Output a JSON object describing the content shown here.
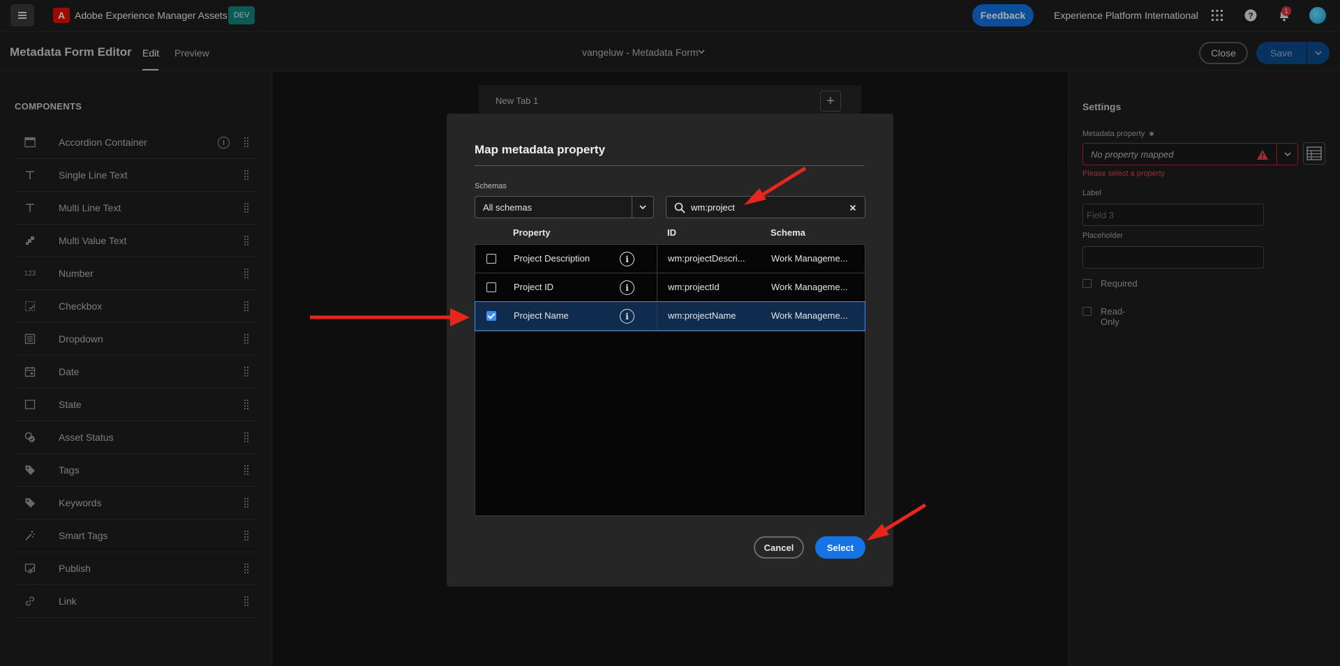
{
  "topbar": {
    "app_title": "Adobe Experience Manager Assets",
    "env_badge": "DEV",
    "feedback_label": "Feedback",
    "org_name": "Experience Platform International",
    "notification_count": "1"
  },
  "editor": {
    "title": "Metadata Form Editor",
    "tabs": [
      {
        "label": "Edit",
        "active": true
      },
      {
        "label": "Preview",
        "active": false
      }
    ],
    "form_name": "vangeluw - Metadata Form",
    "close_label": "Close",
    "save_label": "Save"
  },
  "components": {
    "heading": "COMPONENTS",
    "items": [
      {
        "label": "Accordion Container",
        "icon": "accordion-icon"
      },
      {
        "label": "Single Line Text",
        "icon": "text-icon"
      },
      {
        "label": "Multi Line Text",
        "icon": "text-icon"
      },
      {
        "label": "Multi Value Text",
        "icon": "multi-value-icon"
      },
      {
        "label": "Number",
        "icon": "number-icon"
      },
      {
        "label": "Checkbox",
        "icon": "checkbox-icon"
      },
      {
        "label": "Dropdown",
        "icon": "dropdown-icon"
      },
      {
        "label": "Date",
        "icon": "calendar-icon"
      },
      {
        "label": "State",
        "icon": "state-icon"
      },
      {
        "label": "Asset Status",
        "icon": "asset-status-icon"
      },
      {
        "label": "Tags",
        "icon": "tag-icon"
      },
      {
        "label": "Keywords",
        "icon": "tag-icon"
      },
      {
        "label": "Smart Tags",
        "icon": "magic-wand-icon"
      },
      {
        "label": "Publish",
        "icon": "publish-icon"
      },
      {
        "label": "Link",
        "icon": "link-icon"
      }
    ],
    "number_icon_text": "123"
  },
  "canvas": {
    "tab_label": "New Tab 1",
    "add_symbol": "+"
  },
  "settings": {
    "heading": "Settings",
    "metadata_property_label": "Metadata property",
    "required_marker": "✱",
    "metadata_property_value": "No property mapped",
    "error_text": "Please select a property",
    "label_label": "Label",
    "label_placeholder": "Field 3",
    "placeholder_label": "Placeholder",
    "placeholder_value": "",
    "required_label": "Required",
    "readonly_label": "Read-Only"
  },
  "dialog": {
    "title": "Map metadata property",
    "schemas_label": "Schemas",
    "schema_value": "All schemas",
    "search_value": "wm:project",
    "columns": {
      "property": "Property",
      "id": "ID",
      "schema": "Schema"
    },
    "rows": [
      {
        "property": "Project Description",
        "id": "wm:projectDescri...",
        "schema": "Work Manageme...",
        "checked": false
      },
      {
        "property": "Project ID",
        "id": "wm:projectId",
        "schema": "Work Manageme...",
        "checked": false
      },
      {
        "property": "Project Name",
        "id": "wm:projectName",
        "schema": "Work Manageme...",
        "checked": true
      }
    ],
    "cancel_label": "Cancel",
    "select_label": "Select"
  },
  "colors": {
    "accent": "#1473e6",
    "error": "#e34850",
    "annotation_arrow": "#e8271c",
    "env_badge": "#12857f"
  }
}
